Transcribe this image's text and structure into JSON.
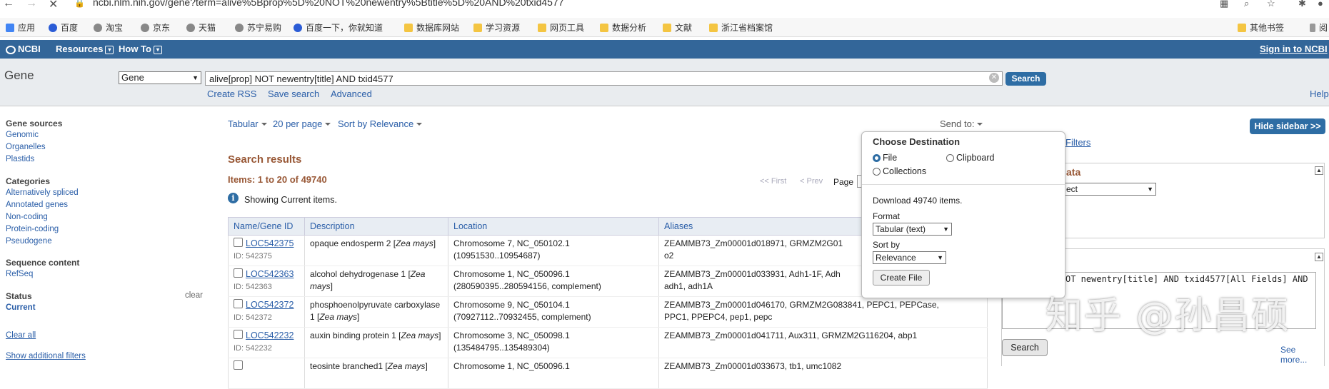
{
  "browser": {
    "url": "ncbi.nlm.nih.gov/gene?term=alive%5Bprop%5D%20NOT%20newentry%5Btitle%5D%20AND%20txid4577",
    "bookmarks": [
      "应用",
      "百度",
      "淘宝",
      "京东",
      "天猫",
      "苏宁易购",
      "百度一下，你就知道",
      "数据库网站",
      "学习资源",
      "网页工具",
      "数据分析",
      "文献",
      "浙江省档案馆",
      "其他书签",
      "阅"
    ]
  },
  "ncbi": {
    "logo": "NCBI",
    "resources": "Resources",
    "howto": "How To",
    "signin": "Sign in to NCBI"
  },
  "search": {
    "app": "Gene",
    "db": "Gene",
    "term": "alive[prop] NOT newentry[title] AND txid4577",
    "button": "Search",
    "create_rss": "Create RSS",
    "save_search": "Save search",
    "advanced": "Advanced",
    "help": "Help"
  },
  "sidebar": {
    "gene_sources": "Gene sources",
    "gene_sources_items": [
      "Genomic",
      "Organelles",
      "Plastids"
    ],
    "categories": "Categories",
    "categories_items": [
      "Alternatively spliced",
      "Annotated genes",
      "Non-coding",
      "Protein-coding",
      "Pseudogene"
    ],
    "sequence_content": "Sequence content",
    "sequence_items": [
      "RefSeq"
    ],
    "status": "Status",
    "clear": "clear",
    "current": "Current",
    "clear_all": "Clear all",
    "show_filters": "Show additional filters"
  },
  "results": {
    "format": "Tabular",
    "per_page": "20 per page",
    "sort": "Sort by Relevance",
    "send_to": "Send to:",
    "heading": "Search results",
    "items": "Items: 1 to 20 of 49740",
    "first": "<< First",
    "prev": "< Prev",
    "page": "Page",
    "showing": "Showing Current items.",
    "columns": [
      "Name/Gene ID",
      "Description",
      "Location",
      "Aliases"
    ],
    "rows": [
      {
        "name": "LOC542375",
        "id": "ID: 542375",
        "desc": "opaque endosperm 2 [",
        "species": "Zea mays",
        "desc_end": "]",
        "loc1": "Chromosome 7, NC_050102.1",
        "loc2": "(10951530..10954687)",
        "alias1": "ZEAMMB73_Zm00001d018971, GRMZM2G01",
        "alias2": "o2"
      },
      {
        "name": "LOC542363",
        "id": "ID: 542363",
        "desc": "alcohol dehydrogenase 1 [",
        "species": "Zea mays",
        "desc_end": "]",
        "loc1": "Chromosome 1, NC_050096.1",
        "loc2": "(280590395..280594156, complement)",
        "alias1": "ZEAMMB73_Zm00001d033931, Adh1-1F, Adh",
        "alias2": "adh1, adh1A"
      },
      {
        "name": "LOC542372",
        "id": "ID: 542372",
        "desc": "phosphoenolpyruvate carboxylase 1 [",
        "species": "Zea mays",
        "desc_end": "]",
        "loc1": "Chromosome 9, NC_050104.1",
        "loc2": "(70927112..70932455, complement)",
        "alias1": "ZEAMMB73_Zm00001d046170, GRMZM2G083841, PEPC1, PEPCase,",
        "alias2": "PPC1, PPEPC4, pep1, pepc"
      },
      {
        "name": "LOC542232",
        "id": "ID: 542232",
        "desc": "auxin binding protein 1 [",
        "species": "Zea mays",
        "desc_end": "]",
        "loc1": "Chromosome 3, NC_050098.1",
        "loc2": "(135484795..135489304)",
        "alias1": "ZEAMMB73_Zm00001d041711, Aux311, GRMZM2G116204, abp1",
        "alias2": ""
      },
      {
        "name": "",
        "id": "",
        "desc": "teosinte branched1 [",
        "species": "Zea mays",
        "desc_end": "]",
        "loc1": "Chromosome 1, NC_050096.1",
        "loc2": "",
        "alias1": "ZEAMMB73_Zm00001d033673, tb1, umc1082",
        "alias2": ""
      }
    ]
  },
  "popup": {
    "title": "Choose Destination",
    "file": "File",
    "clipboard": "Clipboard",
    "collections": "Collections",
    "download": "Download 49740 items.",
    "format_label": "Format",
    "format_value": "Tabular (text)",
    "sort_label": "Sort by",
    "sort_value": "Relevance",
    "create_file": "Create File"
  },
  "right": {
    "hide_sidebar": "Hide sidebar >>",
    "filters": "Filters",
    "ata": "ata",
    "select_value": "ect",
    "query_text": "OT newentry[title] AND txid4577[All Fields] AND",
    "search": "Search",
    "see_more": "See more..."
  },
  "watermark": "知乎 @孙昌硕"
}
